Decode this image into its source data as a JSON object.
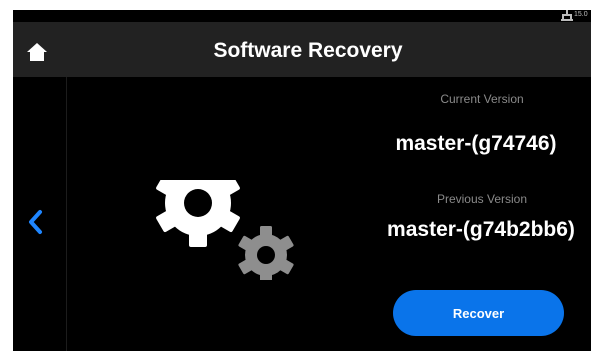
{
  "status_bar": {
    "icon": "network-icon",
    "text": "15.0"
  },
  "header": {
    "title": "Software Recovery",
    "home_icon": "home-icon"
  },
  "nav": {
    "back_icon": "chevron-left-icon"
  },
  "versions": {
    "current_label": "Current Version",
    "current_value": "master-(g74746)",
    "previous_label": "Previous Version",
    "previous_value": "master-(g74b2bb6)"
  },
  "actions": {
    "recover_label": "Recover"
  },
  "illustration": {
    "icon": "gears-icon"
  },
  "colors": {
    "background": "#000000",
    "header": "#222222",
    "accent": "#0a74ea",
    "muted_text": "#8a8a8a"
  }
}
